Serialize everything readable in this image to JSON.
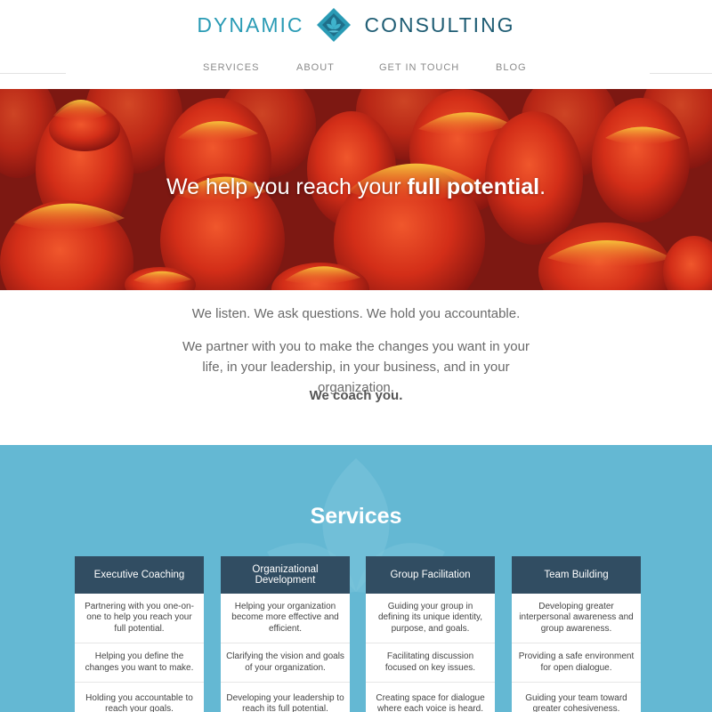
{
  "brand": {
    "left_word": "DYNAMIC",
    "right_word": "CONSULTING",
    "logo_icon": "diamond-lotus-icon",
    "color_primary": "#2a9bb5",
    "color_dark": "#1f5d74"
  },
  "nav": {
    "items": [
      {
        "label": "SERVICES"
      },
      {
        "label": "ABOUT"
      },
      {
        "label": "GET IN TOUCH"
      },
      {
        "label": "BLOG"
      }
    ]
  },
  "hero": {
    "text_prefix": "We help you reach your ",
    "text_bold": "full potential",
    "text_suffix": ".",
    "image_subject": "red and yellow tulips"
  },
  "intro": {
    "line1": "We listen. We ask questions. We hold you accountable.",
    "line2": "We partner with you to make the changes you want in your life, in your leadership, in your business, and in your organization.",
    "line3": "We coach you."
  },
  "services": {
    "title": "Services",
    "section_color": "#64b8d3",
    "card_header_color": "#314d62",
    "cards": [
      {
        "title": "Executive Coaching",
        "items": [
          "Partnering with you one-on-one to help you reach your full potential.",
          "Helping you define the changes you want to make.",
          "Holding you accountable to reach your goals."
        ]
      },
      {
        "title": "Organizational Development",
        "items": [
          "Helping your organization become more effective and efficient.",
          "Clarifying the vision and goals of your organization.",
          "Developing your leadership to reach its full potential."
        ]
      },
      {
        "title": "Group Facilitation",
        "items": [
          "Guiding your group in defining its unique identity, purpose, and goals.",
          "Facilitating discussion focused on key issues.",
          "Creating space for dialogue where each voice is heard."
        ]
      },
      {
        "title": "Team Building",
        "items": [
          "Developing greater interpersonal awareness and group awareness.",
          "Providing a safe environment for open dialogue.",
          "Guiding your team toward greater cohesiveness."
        ]
      }
    ]
  }
}
